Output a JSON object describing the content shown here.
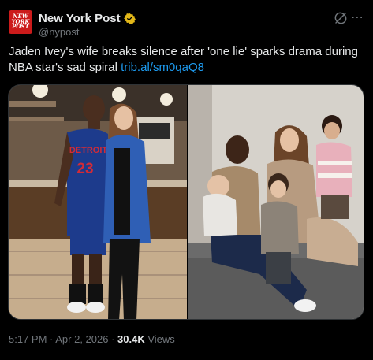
{
  "account": {
    "avatar_text": [
      "NEW",
      "YORK",
      "POST"
    ],
    "display_name": "New York Post",
    "handle": "@nypost",
    "verified_badge": "gold-verified-badge-icon"
  },
  "post": {
    "text": "Jaden Ivey's wife breaks silence after 'one lie' sparks drama during NBA star's sad spiral ",
    "link": "trib.al/sm0qaQ8",
    "jersey_team": "DETROIT",
    "jersey_number": "23"
  },
  "meta": {
    "time": "5:17 PM",
    "separator": " · ",
    "date": "Apr 2, 2026",
    "views_count": "30.4K",
    "views_label": " Views"
  },
  "icons": {
    "grok": "grok-icon",
    "more": "more-options-icon"
  },
  "colors": {
    "link": "#1d9bf0",
    "brand_red": "#cc1b1b",
    "verified_gold": "#e2b719",
    "muted": "#71767b"
  }
}
